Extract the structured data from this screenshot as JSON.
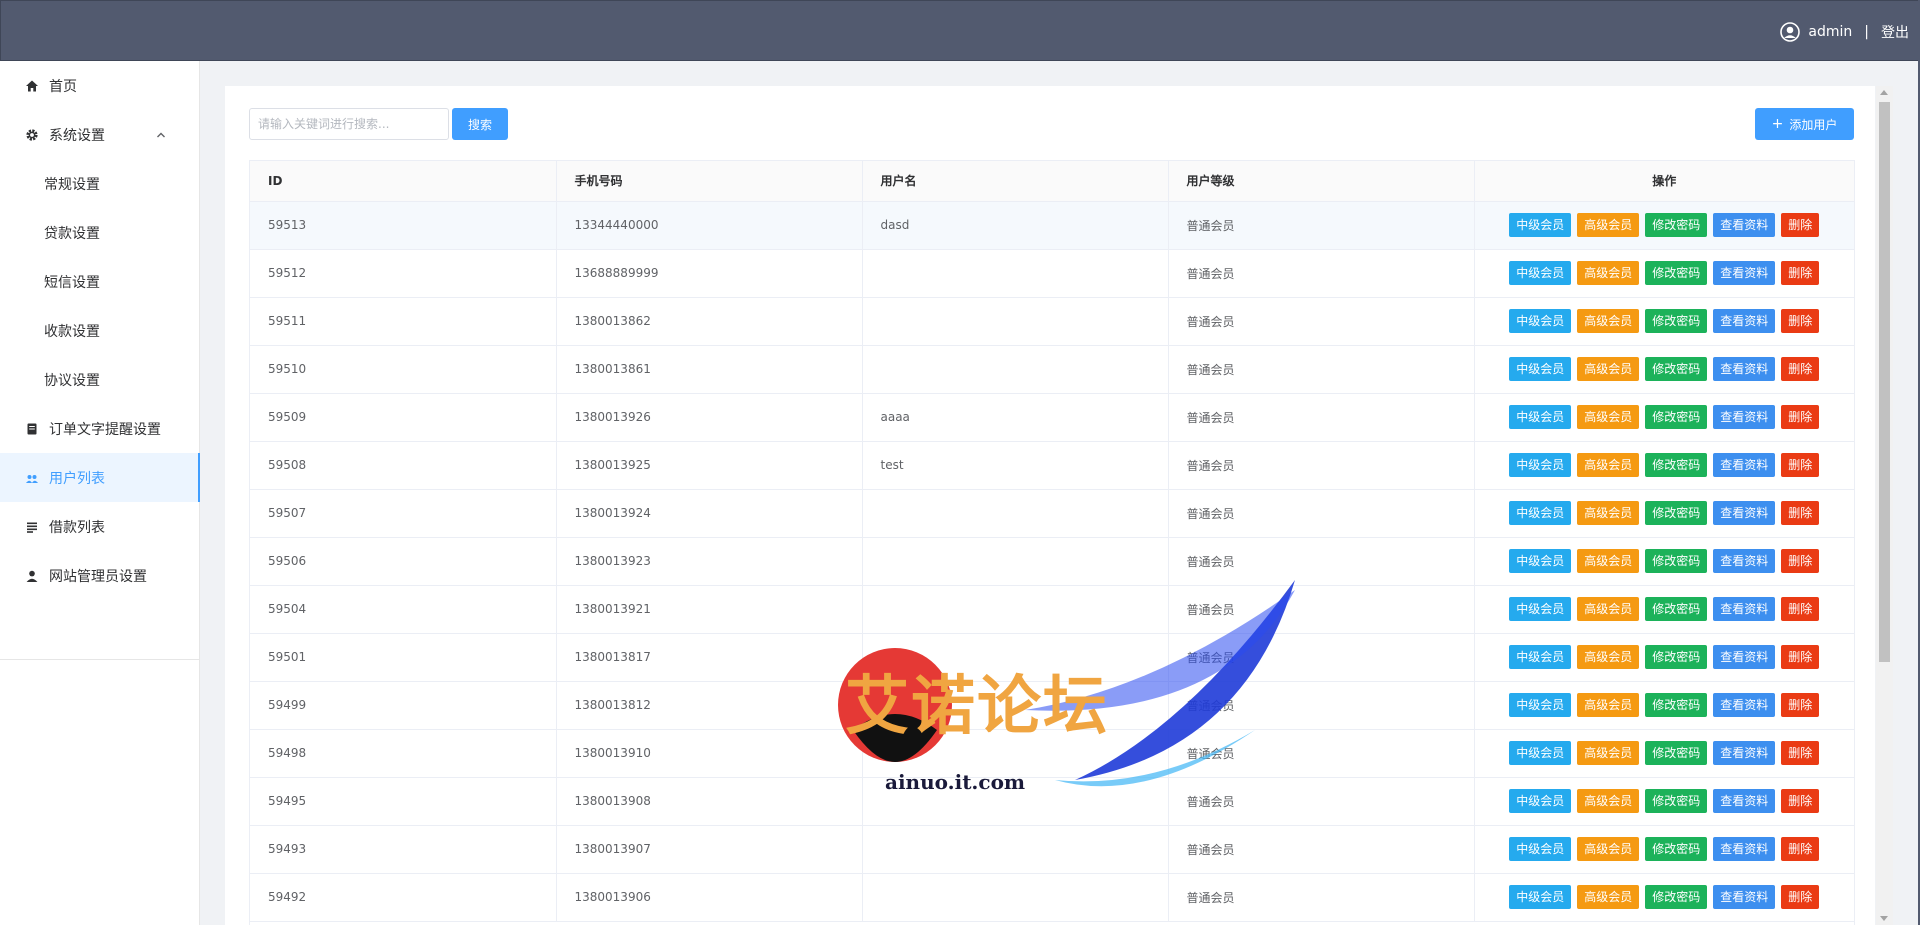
{
  "header": {
    "username": "admin",
    "separator": "|",
    "logout_label": "登出",
    "avatar_icon": "user-avatar-icon"
  },
  "sidebar": {
    "items": [
      {
        "label": "首页",
        "icon": "home-icon",
        "type": "main"
      },
      {
        "label": "系统设置",
        "icon": "gear-icon",
        "type": "group",
        "expanded": true
      },
      {
        "label": "常规设置",
        "type": "sub"
      },
      {
        "label": "贷款设置",
        "type": "sub"
      },
      {
        "label": "短信设置",
        "type": "sub"
      },
      {
        "label": "收款设置",
        "type": "sub"
      },
      {
        "label": "协议设置",
        "type": "sub"
      },
      {
        "label": "订单文字提醒设置",
        "icon": "document-icon",
        "type": "main"
      },
      {
        "label": "用户列表",
        "icon": "users-icon",
        "type": "main",
        "active": true
      },
      {
        "label": "借款列表",
        "icon": "list-icon",
        "type": "main"
      },
      {
        "label": "网站管理员设置",
        "icon": "user-icon",
        "type": "main"
      }
    ]
  },
  "toolbar": {
    "search_placeholder": "请输入关键词进行搜索...",
    "search_label": "搜索",
    "add_user_label": "添加用户"
  },
  "table": {
    "columns": [
      "ID",
      "手机号码",
      "用户名",
      "用户等级",
      "操作"
    ],
    "actions": [
      "中级会员",
      "高级会员",
      "修改密码",
      "查看资料",
      "删除"
    ],
    "rows": [
      {
        "id": "59513",
        "phone": "13344440000",
        "username": "dasd",
        "level": "普通会员"
      },
      {
        "id": "59512",
        "phone": "13688889999",
        "username": "",
        "level": "普通会员"
      },
      {
        "id": "59511",
        "phone": "1380013862",
        "username": "",
        "level": "普通会员"
      },
      {
        "id": "59510",
        "phone": "1380013861",
        "username": "",
        "level": "普通会员"
      },
      {
        "id": "59509",
        "phone": "1380013926",
        "username": "aaaa",
        "level": "普通会员"
      },
      {
        "id": "59508",
        "phone": "1380013925",
        "username": "test",
        "level": "普通会员"
      },
      {
        "id": "59507",
        "phone": "1380013924",
        "username": "",
        "level": "普通会员"
      },
      {
        "id": "59506",
        "phone": "1380013923",
        "username": "",
        "level": "普通会员"
      },
      {
        "id": "59504",
        "phone": "1380013921",
        "username": "",
        "level": "普通会员"
      },
      {
        "id": "59501",
        "phone": "1380013817",
        "username": "",
        "level": "普通会员"
      },
      {
        "id": "59499",
        "phone": "1380013812",
        "username": "",
        "level": "普通会员"
      },
      {
        "id": "59498",
        "phone": "1380013910",
        "username": "",
        "level": "普通会员"
      },
      {
        "id": "59495",
        "phone": "1380013908",
        "username": "",
        "level": "普通会员"
      },
      {
        "id": "59493",
        "phone": "1380013907",
        "username": "",
        "level": "普通会员"
      },
      {
        "id": "59492",
        "phone": "1380013906",
        "username": "",
        "level": "普通会员"
      }
    ]
  },
  "watermark": {
    "title": "艾诺论坛",
    "url": "ainuo.it.com"
  },
  "colors": {
    "topbar": "#525a6f",
    "accent": "#409eff",
    "mid_member": "#25aaee",
    "high_member": "#f59a12",
    "change_password": "#1cb25a",
    "view_profile": "#3d8fef",
    "delete": "#ea3b14"
  }
}
